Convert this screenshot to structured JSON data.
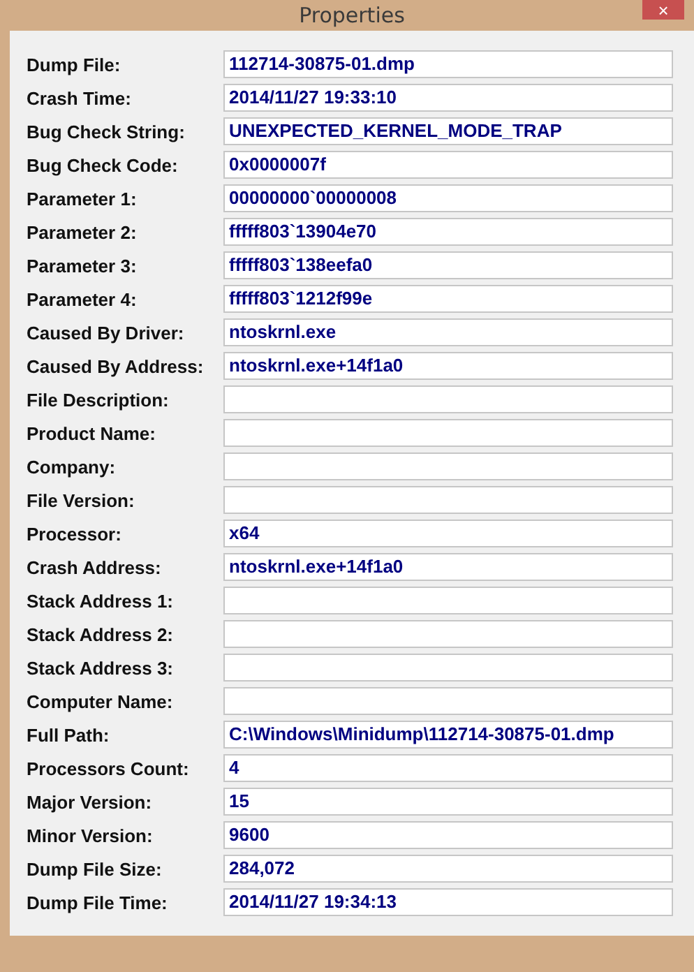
{
  "window": {
    "title": "Properties",
    "close": "×"
  },
  "fields": [
    {
      "label": "Dump File:",
      "value": "112714-30875-01.dmp"
    },
    {
      "label": "Crash Time:",
      "value": "2014/11/27 19:33:10"
    },
    {
      "label": "Bug Check String:",
      "value": "UNEXPECTED_KERNEL_MODE_TRAP"
    },
    {
      "label": "Bug Check Code:",
      "value": "0x0000007f"
    },
    {
      "label": "Parameter 1:",
      "value": "00000000`00000008"
    },
    {
      "label": "Parameter 2:",
      "value": "fffff803`13904e70"
    },
    {
      "label": "Parameter 3:",
      "value": "fffff803`138eefa0"
    },
    {
      "label": "Parameter 4:",
      "value": "fffff803`1212f99e"
    },
    {
      "label": "Caused By Driver:",
      "value": "ntoskrnl.exe"
    },
    {
      "label": "Caused By Address:",
      "value": "ntoskrnl.exe+14f1a0"
    },
    {
      "label": "File Description:"
    },
    {
      "label": "Product Name:"
    },
    {
      "label": "Company:"
    },
    {
      "label": "File Version:"
    },
    {
      "label": "Processor:",
      "value": "x64"
    },
    {
      "label": "Crash Address:",
      "value": "ntoskrnl.exe+14f1a0"
    },
    {
      "label": "Stack Address 1:"
    },
    {
      "label": "Stack Address 2:"
    },
    {
      "label": "Stack Address 3:"
    },
    {
      "label": "Computer Name:"
    },
    {
      "label": "Full Path:",
      "value": "C:\\Windows\\Minidump\\112714-30875-01.dmp"
    },
    {
      "label": "Processors Count:",
      "value": "4"
    },
    {
      "label": "Major Version:",
      "value": "15"
    },
    {
      "label": "Minor Version:",
      "value": "9600"
    },
    {
      "label": "Dump File Size:",
      "value": "284,072"
    },
    {
      "label": "Dump File Time:",
      "value": "2014/11/27 19:34:13"
    }
  ]
}
